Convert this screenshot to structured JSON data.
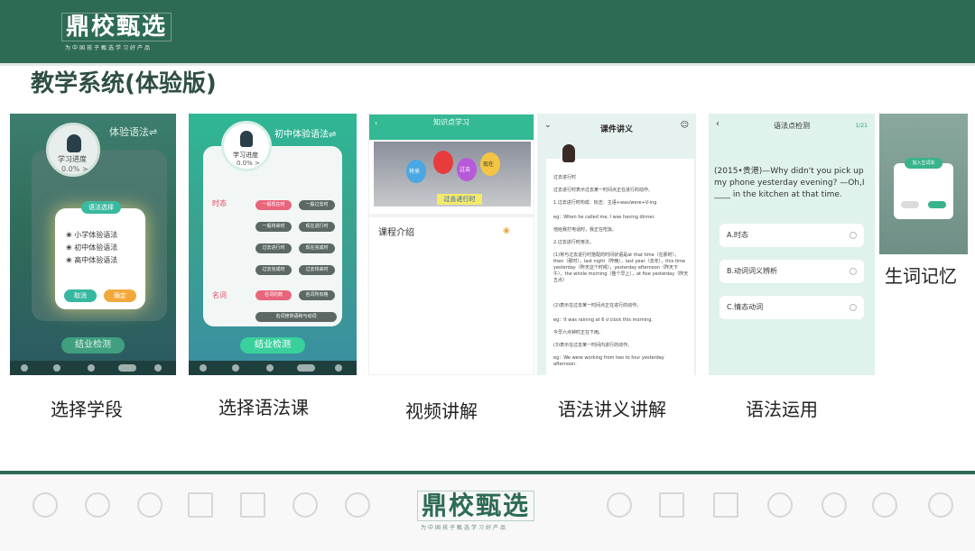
{
  "header": {
    "logo_text": "鼎校甄选",
    "logo_sub": "为中国孩子甄选学习好产品"
  },
  "page_title": "教学系统(体验版)",
  "panels": {
    "p1": {
      "title": "体验语法⇌",
      "progress_label": "学习进度",
      "progress_value": "0.0% >",
      "modal_title": "语法选择",
      "options": [
        "小学体验语法",
        "初中体验语法",
        "高中体验语法"
      ],
      "btn_cancel": "取消",
      "btn_ok": "确定",
      "check_btn": "结业检测"
    },
    "p2": {
      "title": "初中体验语法⇌",
      "progress_label": "学习进度",
      "progress_value": "0.0% >",
      "section_tense": "时态",
      "section_noun": "名词",
      "pills": [
        "一般现在时",
        "一般过去时",
        "一般将来时",
        "现在进行时",
        "过去进行时",
        "现在完成时",
        "过去完成时",
        "过去将来时",
        "名词的数",
        "名词所有格",
        "名词修饰语和与动词"
      ],
      "check_btn": "结业检测"
    },
    "p3": {
      "top_bar": "知识点学习",
      "balloons": [
        "将来",
        "过去",
        "现在"
      ],
      "banner": "过去进行时",
      "intro": "课程介绍"
    },
    "p4": {
      "title": "课件讲义",
      "lines": [
        "过去进行时",
        "过去进行时表示过去某一时间点正在进行的动作。",
        "1.过去进行时构成：标志：主语+was/were+V-ing",
        "eg：When he called me, I was having dinner.",
        "他给我打电话时，我正在吃饭。",
        "2.过去进行时用法。",
        "(1)常与过去进行时搭配的时间状语是at that time（在那时），then（那时），last night（昨晚），last year（去年），this time yesterday（昨天这个时候），yesterday afternoon（昨天下午），the whole morning（整个早上），at five yesterday（昨天五点）",
        "(2)表示在过去某一时间点正在进行的动作。",
        "eg：It was raining at 6 o'clock this morning.",
        "今早六点钟时正在下雨。",
        "(3)表示在过去某一时间内进行的动作。",
        "eg：We were working from two to four yesterday afternoon."
      ]
    },
    "p5": {
      "title": "语法点检测",
      "count": "1/21",
      "question": "(2015•贵港)—Why didn't you pick up my phone yesterday evening? —Oh,I ____ in the kitchen at that time.",
      "options": [
        "A.时态",
        "B.动词词义辨析",
        "C.情态动词"
      ]
    },
    "p6": {
      "dialog_title": "加入生词本"
    }
  },
  "captions": [
    "选择学段",
    "选择语法课",
    "视频讲解",
    "语法讲义讲解",
    "语法运用",
    "生词记忆"
  ],
  "footer": {
    "logo_text": "鼎校甄选",
    "logo_sub": "为中国孩子甄选学习好产品",
    "left_icons": [
      "medal-icon",
      "lightbulb-icon",
      "search-icon",
      "triangle-ruler-icon",
      "book-icon",
      "globe-search-icon",
      "head-bulb-icon"
    ],
    "right_icons": [
      "search-icon",
      "triangle-ruler-icon",
      "book-icon",
      "globe-search-icon",
      "head-bulb-icon",
      "network-icon",
      "medal-icon"
    ]
  },
  "colors": {
    "brand_green": "#2e6b55",
    "accent_teal": "#33b993"
  }
}
